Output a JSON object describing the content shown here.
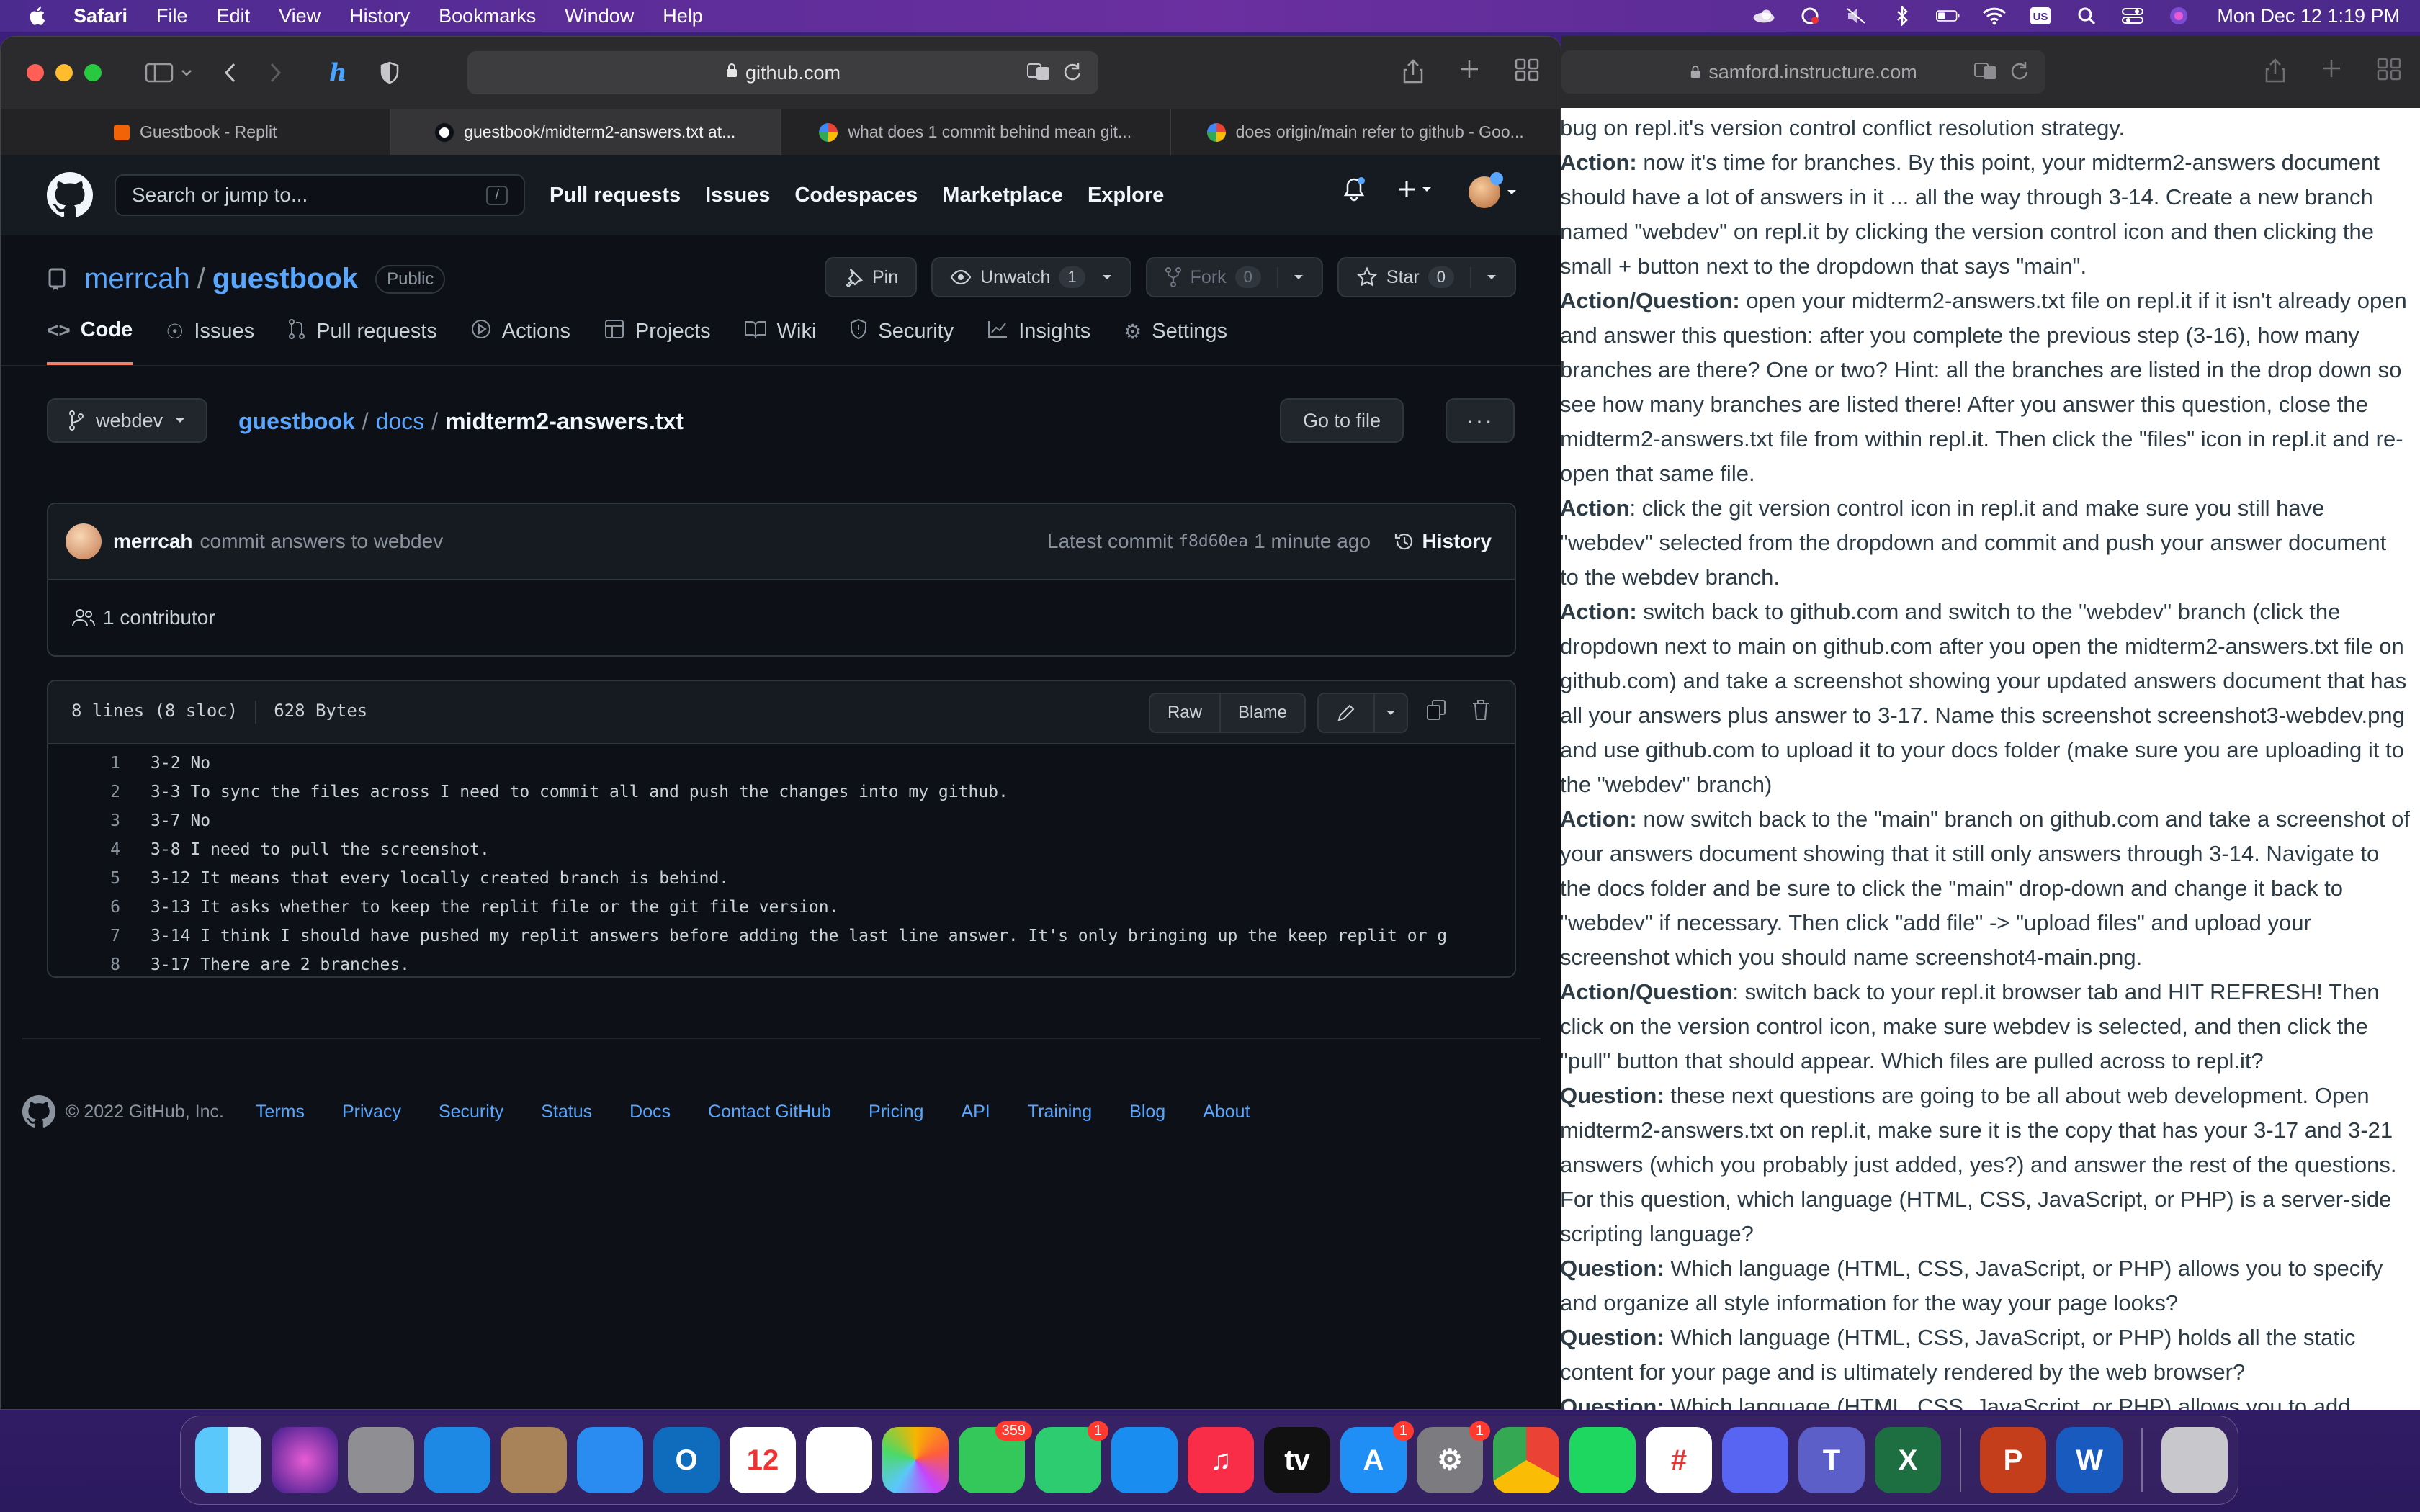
{
  "menubar": {
    "app": "Safari",
    "items": [
      "File",
      "Edit",
      "View",
      "History",
      "Bookmarks",
      "Window",
      "Help"
    ],
    "clock": "Mon Dec 12  1:19 PM"
  },
  "safari": {
    "url": "github.com",
    "tabs": [
      {
        "label": "Guestbook - Replit",
        "color": "#f26207"
      },
      {
        "label": "guestbook/midterm2-answers.txt at...",
        "color": "#ffffff"
      },
      {
        "label": "what does 1 commit behind mean git...",
        "color": "#4285f4"
      },
      {
        "label": "does origin/main refer to github - Goo...",
        "color": "#4285f4"
      }
    ]
  },
  "github": {
    "search_placeholder": "Search or jump to...",
    "search_key": "/",
    "nav": [
      "Pull requests",
      "Issues",
      "Codespaces",
      "Marketplace",
      "Explore"
    ],
    "repo": {
      "owner": "merrcah",
      "sep": "/",
      "name": "guestbook",
      "visibility": "Public",
      "pin": "Pin",
      "unwatch": "Unwatch",
      "watch_count": "1",
      "fork": "Fork",
      "fork_count": "0",
      "star": "Star",
      "star_count": "0"
    },
    "tabs": [
      "Code",
      "Issues",
      "Pull requests",
      "Actions",
      "Projects",
      "Wiki",
      "Security",
      "Insights",
      "Settings"
    ],
    "branch": "webdev",
    "breadcrumb": {
      "root": "guestbook",
      "folder": "docs",
      "file": "midterm2-answers.txt",
      "sep": "/"
    },
    "goto_file": "Go to file",
    "more": "···",
    "commit": {
      "author": "merrcah",
      "message": "commit answers to webdev",
      "latest_label": "Latest commit",
      "sha": "f8d60ea",
      "time": "1 minute ago",
      "history": "History"
    },
    "contributors": "1 contributor",
    "file": {
      "lines_info": "8 lines (8 sloc)",
      "size": "628 Bytes",
      "raw": "Raw",
      "blame": "Blame",
      "lines": [
        "3-2 No",
        "3-3 To sync the files across I need to commit all and push the changes into my github.",
        "3-7 No",
        "3-8 I need to pull the screenshot.",
        "3-12 It means that every locally created branch is behind.",
        "3-13 It asks whether to keep the replit file or the git file version.",
        "3-14 I think I should have pushed my replit answers before adding the last line answer. It's only bringing up the keep replit or g",
        "3-17 There are 2 branches."
      ]
    },
    "footer": {
      "copyright": "© 2022 GitHub, Inc.",
      "links": [
        "Terms",
        "Privacy",
        "Security",
        "Status",
        "Docs",
        "Contact GitHub",
        "Pricing",
        "API",
        "Training",
        "Blog",
        "About"
      ]
    }
  },
  "canvas": {
    "url": "samford.instructure.com",
    "paragraphs": [
      {
        "label": "",
        "text": "bug on repl.it's version control conflict resolution strategy."
      },
      {
        "label": "Action:",
        "text": " now it's time for branches. By this point, your midterm2-answers document should have a lot of answers in it ... all the way through 3-14. Create a new branch named \"webdev\" on repl.it by clicking the version control icon and then clicking the small + button next to the dropdown that says \"main\"."
      },
      {
        "label": "Action/Question:",
        "text": " open your midterm2-answers.txt file on repl.it if it isn't already open and answer this question: after you complete the previous step (3-16), how many branches are there? One or two? Hint: all the branches are listed in the drop down so see how many branches are listed there! After you answer this question, close the midterm2-answers.txt file from within repl.it. Then click the \"files\" icon in repl.it and re-open that same file."
      },
      {
        "label": "Action",
        "text": ": click the git version control icon in repl.it and make sure you still have \"webdev\" selected from the dropdown and commit and push your answer document to the webdev branch."
      },
      {
        "label": "Action:",
        "text": " switch back to github.com and switch to the \"webdev\" branch (click the dropdown next to main on github.com after you open the midterm2-answers.txt file on github.com) and take a screenshot showing your updated answers document that has all your answers plus answer to 3-17. Name this screenshot screenshot3-webdev.png and use github.com to upload it to your docs folder (make sure you are uploading it to the \"webdev\" branch)"
      },
      {
        "label": "Action:",
        "text": " now switch back to the \"main\" branch on github.com and take a screenshot of your answers document showing that it still only answers through 3-14. Navigate to the docs folder and be sure to click the \"main\" drop-down and change it back to \"webdev\" if necessary. Then click \"add file\" -> \"upload files\" and upload your screenshot which you should name screenshot4-main.png."
      },
      {
        "label": "Action/Question",
        "text": ": switch back to your repl.it browser tab and HIT REFRESH! Then click on the version control icon, make sure webdev is selected, and then click the \"pull\" button that should appear. Which files are pulled across to repl.it?"
      },
      {
        "label": "Question:",
        "text": " these next questions are going to be all about web development. Open midterm2-answers.txt on repl.it, make sure it is the copy that has your 3-17 and 3-21 answers (which you probably just added, yes?) and answer the rest of the questions. For this question, which language (HTML, CSS, JavaScript, or PHP) is a server-side scripting language?"
      },
      {
        "label": "Question:",
        "text": " Which language (HTML, CSS, JavaScript, or PHP) allows you to specify and organize all style information for the way your page looks?"
      },
      {
        "label": "Question:",
        "text": " Which language (HTML, CSS, JavaScript, or PHP) holds all the static content for your page and is ultimately rendered by the web browser?"
      },
      {
        "label": "Question:",
        "text": " Which language (HTML, CSS, JavaScript, or PHP) allows you to add"
      }
    ]
  },
  "dock": {
    "apps": [
      {
        "name": "finder",
        "color": "#2f9bf0",
        "glyph": "",
        "badge": ""
      },
      {
        "name": "siri",
        "color": "#2b1d4a",
        "glyph": "",
        "badge": ""
      },
      {
        "name": "launchpad",
        "color": "#8e8e93",
        "glyph": "",
        "badge": ""
      },
      {
        "name": "safari",
        "color": "#1e88e5",
        "glyph": "",
        "badge": ""
      },
      {
        "name": "contacts",
        "color": "#a8835a",
        "glyph": "",
        "badge": ""
      },
      {
        "name": "mail",
        "color": "#2a8cf0",
        "glyph": "",
        "badge": ""
      },
      {
        "name": "outlook",
        "color": "#0f6cbd",
        "glyph": "O",
        "badge": ""
      },
      {
        "name": "calendar",
        "color": "#ffffff",
        "glyph": "12",
        "badge": ""
      },
      {
        "name": "reminders",
        "color": "#ffffff",
        "glyph": "",
        "badge": ""
      },
      {
        "name": "photos",
        "color": "#ffffff",
        "glyph": "",
        "badge": ""
      },
      {
        "name": "messages",
        "color": "#34c759",
        "glyph": "",
        "badge": "359"
      },
      {
        "name": "facetime",
        "color": "#2ecc71",
        "glyph": "",
        "badge": "1"
      },
      {
        "name": "keynote",
        "color": "#1a8ef0",
        "glyph": "",
        "badge": ""
      },
      {
        "name": "music",
        "color": "#fa2d48",
        "glyph": "♫",
        "badge": ""
      },
      {
        "name": "apple-tv",
        "color": "#111111",
        "glyph": "tv",
        "badge": ""
      },
      {
        "name": "app-store",
        "color": "#1f8ff5",
        "glyph": "A",
        "badge": "1"
      },
      {
        "name": "system-preferences",
        "color": "#7b7b80",
        "glyph": "⚙",
        "badge": "1"
      },
      {
        "name": "chrome",
        "color": "#ffffff",
        "glyph": "",
        "badge": ""
      },
      {
        "name": "spotify",
        "color": "#1ed760",
        "glyph": "",
        "badge": ""
      },
      {
        "name": "slack",
        "color": "#ffffff",
        "glyph": "#",
        "badge": ""
      },
      {
        "name": "discord",
        "color": "#5865f2",
        "glyph": "",
        "badge": ""
      },
      {
        "name": "teams",
        "color": "#5b5fc7",
        "glyph": "T",
        "badge": ""
      },
      {
        "name": "excel",
        "color": "#1d6f42",
        "glyph": "X",
        "badge": ""
      },
      {
        "name": "powerpoint",
        "color": "#c43e1c",
        "glyph": "P",
        "badge": ""
      },
      {
        "name": "word",
        "color": "#185abd",
        "glyph": "W",
        "badge": ""
      },
      {
        "name": "trash",
        "color": "#c8c8cc",
        "glyph": "",
        "badge": ""
      }
    ]
  }
}
